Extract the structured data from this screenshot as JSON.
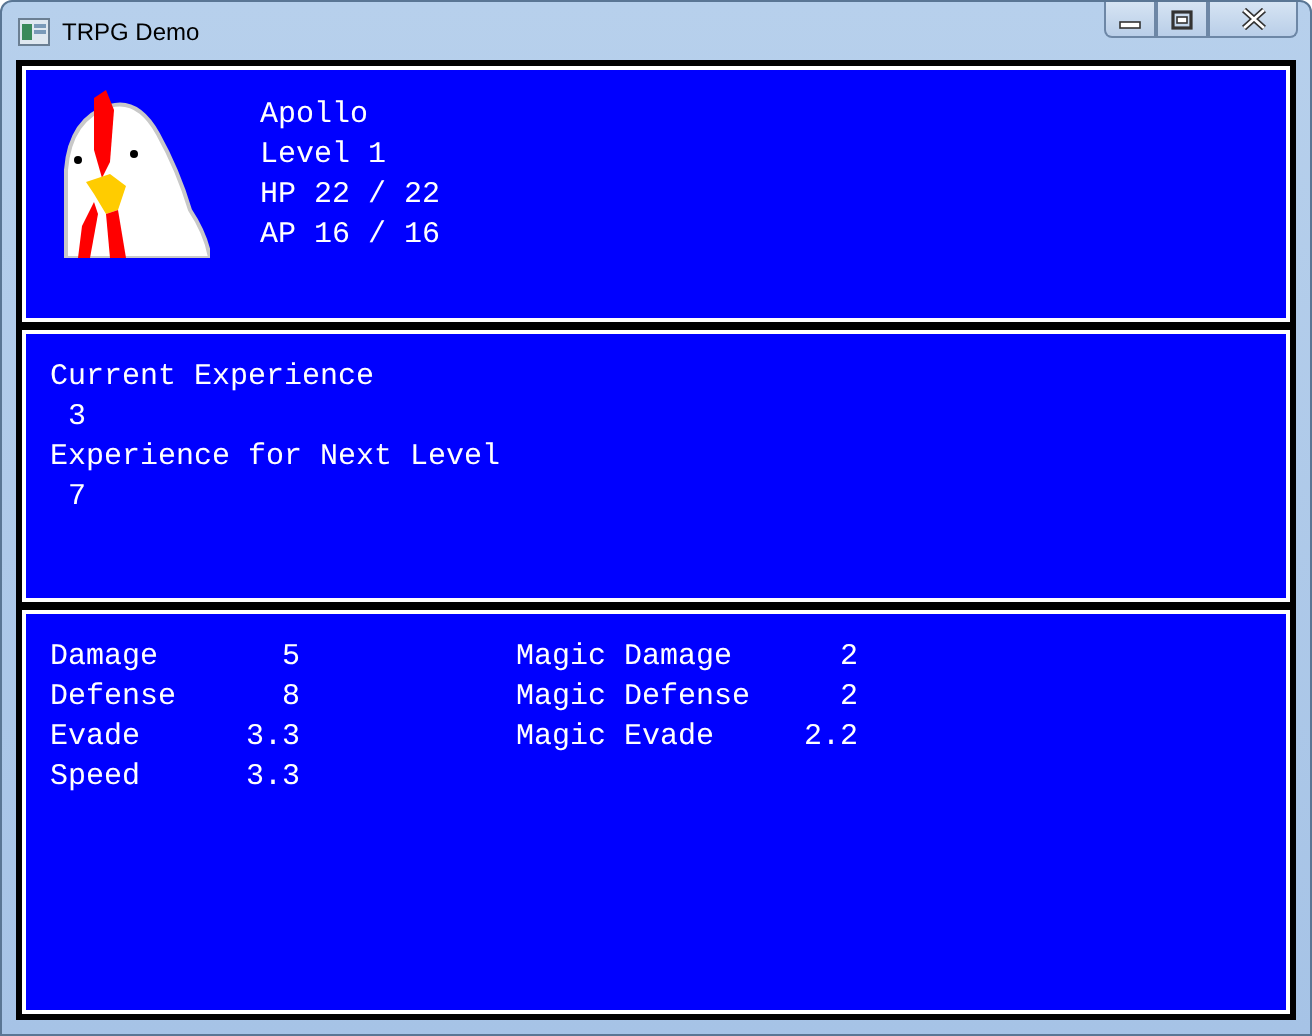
{
  "window": {
    "title": "TRPG Demo"
  },
  "character": {
    "name": "Apollo",
    "lines": [
      "Level 1",
      "HP 22 / 22",
      "AP 16 / 16"
    ]
  },
  "experience": [
    {
      "label": "Current Experience",
      "value": "3"
    },
    {
      "label": "Experience for Next Level",
      "value": "7"
    }
  ],
  "stats": {
    "left": [
      {
        "label": "Damage",
        "value": "5"
      },
      {
        "label": "Defense",
        "value": "8"
      },
      {
        "label": "Evade",
        "value": "3.3"
      },
      {
        "label": "Speed",
        "value": "3.3"
      }
    ],
    "right": [
      {
        "label": "Magic Damage",
        "value": "2"
      },
      {
        "label": "Magic Defense",
        "value": "2"
      },
      {
        "label": "Magic Evade",
        "value": "2.2"
      }
    ]
  }
}
